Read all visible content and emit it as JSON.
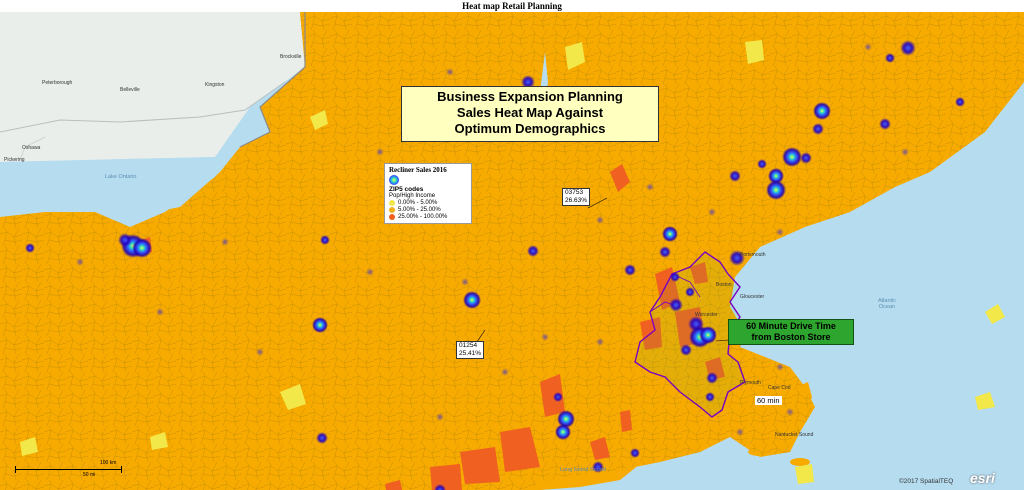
{
  "title": "Heat map Retail Planning",
  "callout": {
    "line1": "Business Expansion Planning",
    "line2": "Sales Heat Map Against",
    "line3": "Optimum Demographics"
  },
  "legend": {
    "title": "Recliner Sales 2016",
    "subtitle": "ZIP5 codes",
    "metric": "Pop/High Income",
    "items": [
      {
        "label": "0.00% - 5.00%",
        "color": "#f2e84a"
      },
      {
        "label": "5.00% - 25.00%",
        "color": "#f0b020"
      },
      {
        "label": "25.00% - 100.00%",
        "color": "#f06020"
      }
    ]
  },
  "zip_labels": [
    {
      "zip": "03753",
      "pct": "26.63%"
    },
    {
      "zip": "01254",
      "pct": "25.41%"
    }
  ],
  "drive_time": {
    "line1": "60 Minute Drive Time",
    "line2": "from Boston Store",
    "ring_label": "60 min"
  },
  "places": [
    "Brockville",
    "Peterborough",
    "Belleville",
    "Kingston",
    "Oshawa",
    "Pickering",
    "Portsmouth",
    "Worcester",
    "Boston",
    "Gloucester",
    "Plymouth",
    "Nantucket Sound",
    "Cape Cod"
  ],
  "water_labels": [
    "Lake Ontario",
    "Atlantic Ocean",
    "Long Island Sound"
  ],
  "scale": {
    "km": "100 km",
    "mi": "50 mi"
  },
  "credit": "©2017 SpatialTEQ",
  "brand": "esri",
  "colors": {
    "land_base": "#f7aa00",
    "low": "#f2e84a",
    "high": "#f06020",
    "water": "#b6dcf0",
    "canada": "#e9eeea",
    "heat": "#2200cc",
    "drive_boundary": "#7a00c0",
    "drive_fill": "#60c640"
  }
}
